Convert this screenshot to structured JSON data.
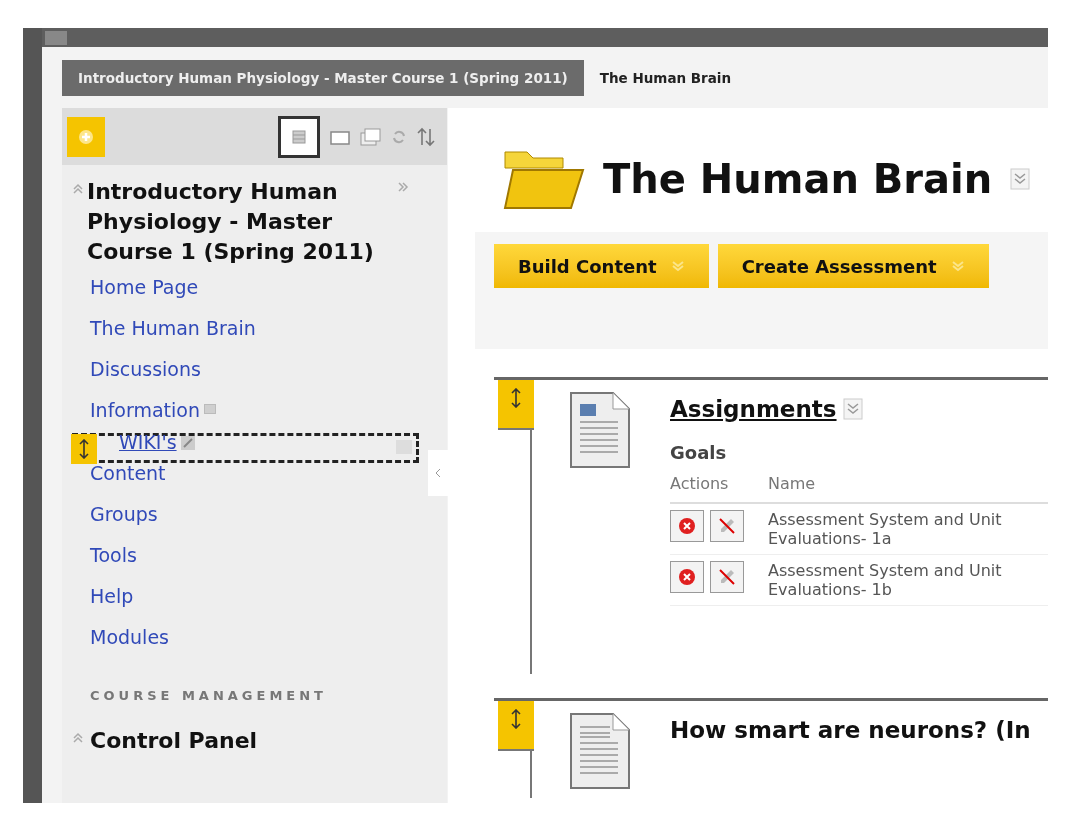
{
  "breadcrumbs": [
    {
      "label": "Introductory Human Physiology - Master Course 1 (Spring 2011)",
      "selected": true
    },
    {
      "label": "The Human Brain",
      "selected": false
    }
  ],
  "sidebar": {
    "course_title": "Introductory Human Physiology - Master Course 1 (Spring 2011)",
    "items": [
      {
        "label": "Home Page",
        "dragging": false,
        "kind": "link"
      },
      {
        "label": "The Human Brain",
        "dragging": false,
        "kind": "link"
      },
      {
        "label": "Discussions",
        "dragging": false,
        "kind": "link"
      },
      {
        "label": "Information",
        "dragging": false,
        "kind": "hidden"
      },
      {
        "label": "WIKI's",
        "dragging": true,
        "kind": "edit"
      },
      {
        "label": "Content",
        "dragging": false,
        "kind": "link"
      },
      {
        "label": "Groups",
        "dragging": false,
        "kind": "link"
      },
      {
        "label": "Tools",
        "dragging": false,
        "kind": "link"
      },
      {
        "label": "Help",
        "dragging": false,
        "kind": "link"
      },
      {
        "label": "Modules",
        "dragging": false,
        "kind": "link"
      }
    ],
    "section_heading": "COURSE MANAGEMENT",
    "control_panel": "Control Panel"
  },
  "page_title": "The Human Brain",
  "action_buttons": [
    "Build Content",
    "Create Assessment"
  ],
  "content_items": [
    {
      "title": "Assignments",
      "kind": "goals",
      "subheading": "Goals",
      "columns": [
        "Actions",
        "Name"
      ],
      "rows": [
        {
          "name": "Assessment System and Unit Evaluations- 1a"
        },
        {
          "name": "Assessment System and Unit Evaluations- 1b"
        }
      ]
    },
    {
      "title": "How smart are neurons? (In",
      "kind": "document"
    }
  ]
}
